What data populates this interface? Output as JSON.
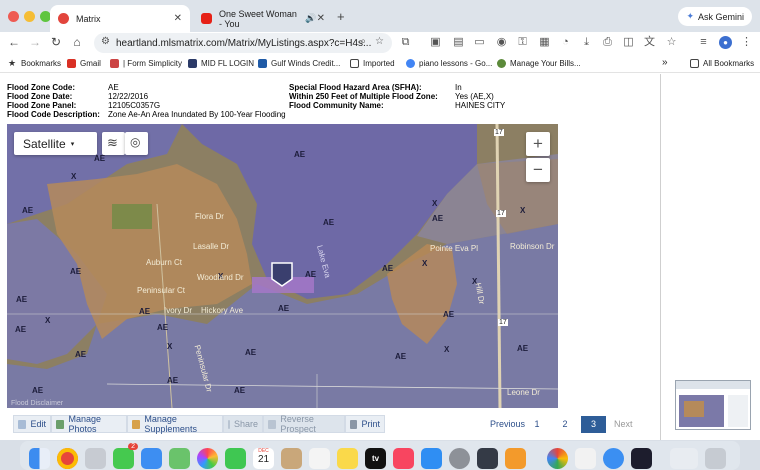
{
  "browser": {
    "tabs": [
      {
        "title": "Matrix",
        "active": true
      },
      {
        "title": "One Sweet Woman - You",
        "active": false
      }
    ],
    "new_tab": "+",
    "ask_gemini": "Ask Gemini",
    "url": "heartland.mlsmatrix.com/Matrix/MyListings.aspx?c=H4s...",
    "bookmarks": [
      {
        "label": "Bookmarks",
        "icon": "star-icon"
      },
      {
        "label": "Gmail",
        "icon": "gmail-icon"
      },
      {
        "label": "| Form Simplicity",
        "icon": "doc-icon"
      },
      {
        "label": "MID FL LOGIN",
        "icon": "mls-icon"
      },
      {
        "label": "Gulf Winds Credit...",
        "icon": "gulf-icon"
      },
      {
        "label": "Imported",
        "icon": "folder-icon"
      },
      {
        "label": "piano lessons - Go...",
        "icon": "google-icon"
      },
      {
        "label": "Manage Your Bills...",
        "icon": "bills-icon"
      }
    ],
    "bookmarks_overflow": "»",
    "all_bookmarks": "All Bookmarks"
  },
  "flood": {
    "zone_code_label": "Flood Zone Code:",
    "zone_code_value": "AE",
    "zone_date_label": "Flood Zone Date:",
    "zone_date_value": "12/22/2016",
    "zone_panel_label": "Flood Zone Panel:",
    "zone_panel_value": "12105C0357G",
    "code_desc_label": "Flood Code Description:",
    "code_desc_value": "Zone Ae-An Area Inundated By 100-Year Flooding",
    "sfha_label": "Special Flood Hazard Area (SFHA):",
    "sfha_value": "In",
    "within_label": "Within 250 Feet of Multiple Flood Zone:",
    "within_value": "Yes (AE,X)",
    "community_label": "Flood Community Name:",
    "community_value": "HAINES CITY"
  },
  "map": {
    "type_button": "Satellite",
    "zoom_in": "+",
    "zoom_out": "−",
    "disclaimer": "Flood Disclaimer",
    "zone_labels": [
      "AE",
      "AE",
      "AE",
      "AE",
      "AE",
      "AE",
      "AE",
      "AE",
      "AE",
      "AE",
      "AE",
      "AE",
      "AE",
      "AE",
      "AE",
      "AE",
      "AE",
      "AE",
      "AE",
      "AE",
      "AE",
      "X",
      "X",
      "X",
      "X",
      "X",
      "X",
      "X",
      "X",
      "X"
    ],
    "streets": [
      "Flora Dr",
      "Lasalle Dr",
      "Auburn Ct",
      "Woodland Dr",
      "Peninsular Ct",
      "Hickory Ave",
      "Ivory Dr",
      "Peninsular Dr",
      "Lake Eva",
      "Pointe Eva Pl",
      "Robinson Dr",
      "Leone Dr",
      "Hill Dr",
      "17",
      "17",
      "17"
    ]
  },
  "actions": [
    {
      "label": "Edit",
      "enabled": true
    },
    {
      "label": "Manage Photos",
      "enabled": true
    },
    {
      "label": "Manage Supplements",
      "enabled": true
    },
    {
      "label": "Share",
      "enabled": false
    },
    {
      "label": "Reverse Prospect",
      "enabled": false
    },
    {
      "label": "Print",
      "enabled": true
    }
  ],
  "pagination": {
    "previous": "Previous",
    "pages": [
      "1",
      "2",
      "3"
    ],
    "current": "3",
    "next": "Next"
  },
  "dock": {
    "calendar_month": "DEC",
    "calendar_day": "21",
    "messages_badge": "2",
    "tv_label": "tv"
  }
}
